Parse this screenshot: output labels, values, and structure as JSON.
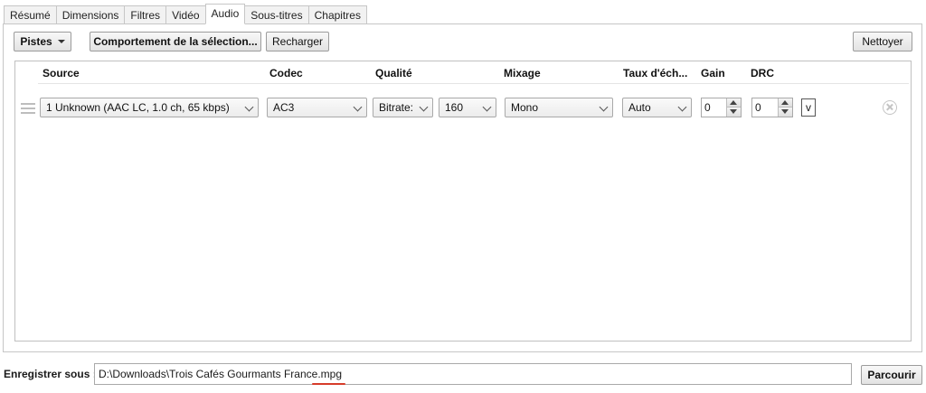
{
  "tabs": [
    {
      "label": "Résumé"
    },
    {
      "label": "Dimensions"
    },
    {
      "label": "Filtres"
    },
    {
      "label": "Vidéo"
    },
    {
      "label": "Audio",
      "active": true
    },
    {
      "label": "Sous-titres"
    },
    {
      "label": "Chapitres"
    }
  ],
  "toolbar": {
    "tracks_label": "Pistes",
    "selection_behavior_label": "Comportement de la sélection...",
    "reload_label": "Recharger",
    "clear_label": "Nettoyer"
  },
  "columns": {
    "source": "Source",
    "codec": "Codec",
    "quality": "Qualité",
    "mixdown": "Mixage",
    "samplerate": "Taux d'éch...",
    "gain": "Gain",
    "drc": "DRC"
  },
  "track": {
    "source": "1 Unknown (AAC LC, 1.0 ch, 65 kbps)",
    "codec": "AC3",
    "quality_mode": "Bitrate:",
    "bitrate": "160",
    "mixdown": "Mono",
    "samplerate": "Auto",
    "gain": "0",
    "drc": "0",
    "extra": "v"
  },
  "destination": {
    "label": "Enregistrer sous :",
    "path": "D:\\Downloads\\Trois Cafés Gourmants France",
    "extension": ".mpg",
    "browse_label": "Parcourir"
  }
}
